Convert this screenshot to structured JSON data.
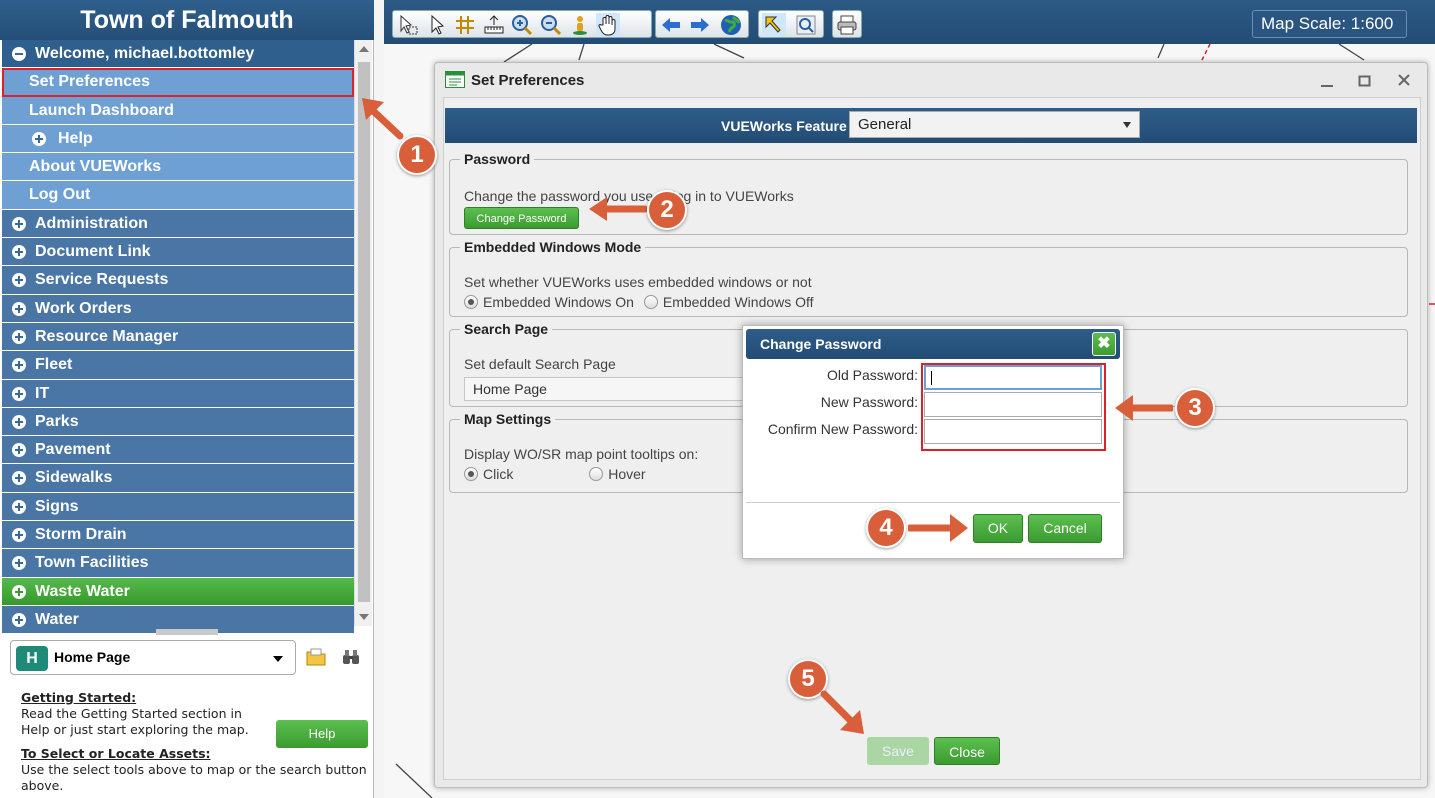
{
  "app": {
    "title": "Town of Falmouth"
  },
  "menu": {
    "welcome": "Welcome, michael.bottomley",
    "sub_items": [
      "Set Preferences",
      "Launch Dashboard",
      "Help",
      "About VUEWorks",
      "Log Out"
    ],
    "groups": [
      "Administration",
      "Document Link",
      "Service Requests",
      "Work Orders",
      "Resource Manager",
      "Fleet",
      "IT",
      "Parks",
      "Pavement",
      "Sidewalks",
      "Signs",
      "Storm Drain",
      "Town Facilities",
      "Waste Water",
      "Water"
    ]
  },
  "homepage": {
    "badge": "H",
    "selected": "Home Page"
  },
  "help_panel": {
    "getting_started_title": "Getting Started:",
    "getting_started_text": "Read the Getting Started section in Help or just start exploring the map.",
    "help_button": "Help",
    "select_title": "To Select or Locate Assets:",
    "select_text": "Use the select tools above to map or the search button above."
  },
  "toolbar": {
    "map_scale": "Map Scale: 1:600"
  },
  "prefs": {
    "title": "Set Preferences",
    "feature_label": "VUEWorks Feature",
    "feature_value": "General",
    "password": {
      "legend": "Password",
      "text": "Change the password you use to log in to VUEWorks",
      "button": "Change Password"
    },
    "embedded": {
      "legend": "Embedded Windows Mode",
      "text": "Set whether VUEWorks uses embedded windows or not",
      "opt_on": "Embedded Windows On",
      "opt_off": "Embedded Windows Off"
    },
    "search": {
      "legend": "Search Page",
      "text": "Set default Search Page",
      "value": "Home Page"
    },
    "map": {
      "legend": "Map Settings",
      "text": "Display WO/SR map point tooltips on:",
      "opt_click": "Click",
      "opt_hover": "Hover"
    },
    "save": "Save",
    "close": "Close"
  },
  "change_password": {
    "title": "Change Password",
    "old_label": "Old Password:",
    "new_label": "New Password:",
    "confirm_label": "Confirm New Password:",
    "ok": "OK",
    "cancel": "Cancel"
  },
  "steps": [
    "1",
    "2",
    "3",
    "4",
    "5"
  ],
  "colors": {
    "accent": "#2e5d89",
    "button_green": "#3b9b30",
    "callout": "#d95f3b",
    "highlight": "#d9222a"
  }
}
